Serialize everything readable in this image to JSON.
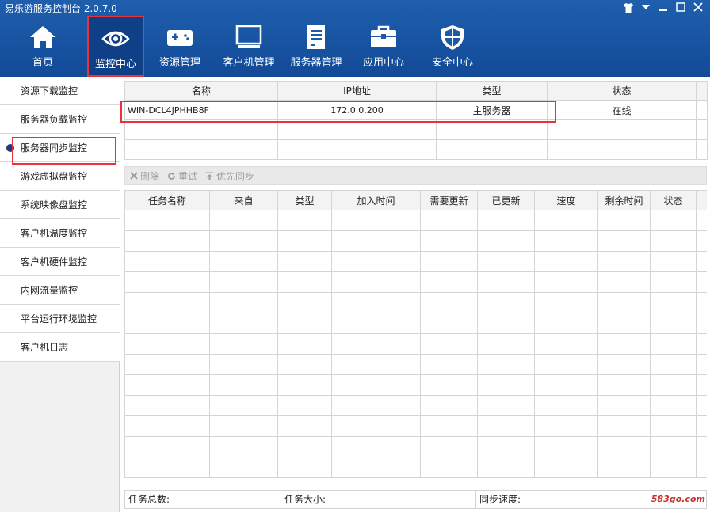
{
  "app": {
    "title": "易乐游服务控制台 2.0.7.0"
  },
  "window_controls": [
    "shirt-icon",
    "dropdown-icon",
    "minimize-icon",
    "maximize-icon",
    "close-icon"
  ],
  "nav": [
    {
      "label": "首页",
      "icon": "home-icon"
    },
    {
      "label": "监控中心",
      "icon": "eye-icon",
      "active": true
    },
    {
      "label": "资源管理",
      "icon": "gamepad-icon"
    },
    {
      "label": "客户机管理",
      "icon": "monitor-icon"
    },
    {
      "label": "服务器管理",
      "icon": "document-icon"
    },
    {
      "label": "应用中心",
      "icon": "toolbox-icon"
    },
    {
      "label": "安全中心",
      "icon": "shield-icon"
    }
  ],
  "sidebar": {
    "items": [
      {
        "label": "资源下载监控"
      },
      {
        "label": "服务器负载监控"
      },
      {
        "label": "服务器同步监控",
        "active": true
      },
      {
        "label": "游戏虚拟盘监控"
      },
      {
        "label": "系统映像盘监控"
      },
      {
        "label": "客户机温度监控"
      },
      {
        "label": "客户机硬件监控"
      },
      {
        "label": "内网流量监控"
      },
      {
        "label": "平台运行环境监控"
      },
      {
        "label": "客户机日志"
      }
    ]
  },
  "server_table": {
    "headers": [
      "名称",
      "IP地址",
      "类型",
      "状态"
    ],
    "rows": [
      [
        "WIN-DCL4JPHHB8F",
        "172.0.0.200",
        "主服务器",
        "在线"
      ]
    ]
  },
  "toolbar": {
    "delete": "删除",
    "retry": "重试",
    "priority_sync": "优先同步"
  },
  "task_table": {
    "headers": [
      "任务名称",
      "来自",
      "类型",
      "加入时间",
      "需要更新",
      "已更新",
      "速度",
      "剩余时间",
      "状态"
    ]
  },
  "footer": {
    "total_tasks": "任务总数:",
    "task_size": "任务大小:",
    "sync_speed": "同步速度:"
  },
  "watermark": "583go.com",
  "colors": {
    "header": "#1a5aa8",
    "highlight": "#e8333a"
  }
}
